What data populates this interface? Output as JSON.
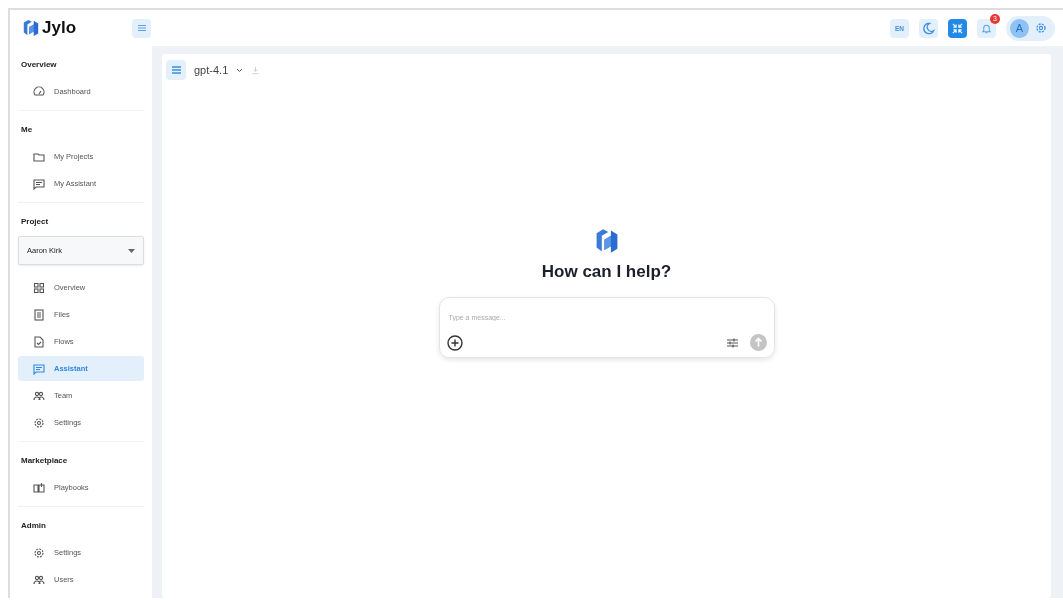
{
  "header": {
    "brand": "Jylo",
    "language": "EN",
    "notifications": "3",
    "avatar": "A"
  },
  "sidebar": {
    "sections": [
      {
        "title": "Overview",
        "items": [
          {
            "label": "Dashboard",
            "selected": false
          }
        ]
      },
      {
        "title": "Me",
        "items": [
          {
            "label": "My Projects",
            "selected": false
          },
          {
            "label": "My Assistant",
            "selected": false
          }
        ]
      },
      {
        "title": "Project",
        "project_select": "Aaron Kirk",
        "items": [
          {
            "label": "Overview",
            "selected": false
          },
          {
            "label": "Files",
            "selected": false
          },
          {
            "label": "Flows",
            "selected": false
          },
          {
            "label": "Assistant",
            "selected": true
          },
          {
            "label": "Team",
            "selected": false
          },
          {
            "label": "Settings",
            "selected": false
          }
        ]
      },
      {
        "title": "Marketplace",
        "items": [
          {
            "label": "Playbooks",
            "selected": false
          }
        ]
      },
      {
        "title": "Admin",
        "items": [
          {
            "label": "Settings",
            "selected": false
          },
          {
            "label": "Users",
            "selected": false
          }
        ]
      }
    ]
  },
  "chat": {
    "model": "gpt-4.1",
    "heading": "How can I help?",
    "composer": {
      "placeholder": "Type a message..."
    }
  }
}
